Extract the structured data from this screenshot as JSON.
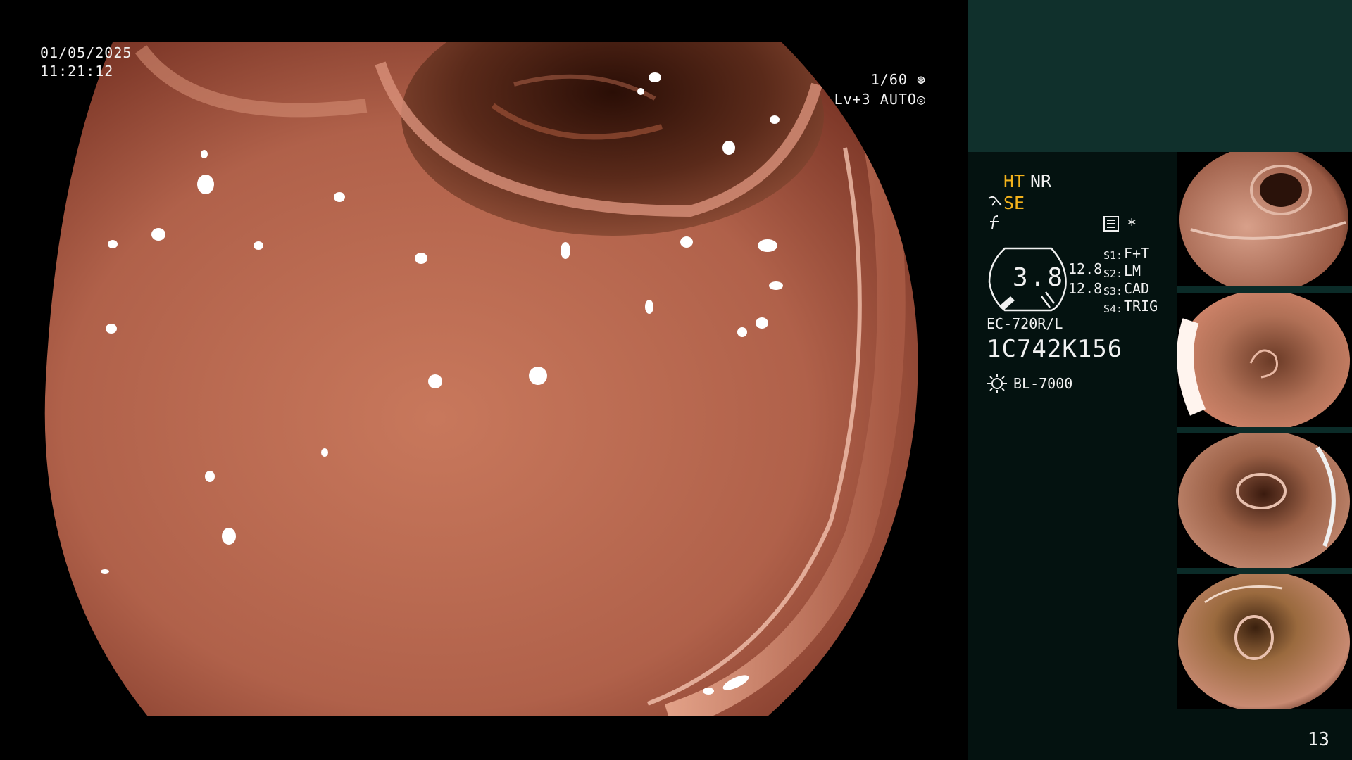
{
  "overlay": {
    "date": "01/05/2025",
    "time": "11:21:12",
    "shutter": "1/60",
    "shutter_icon": "aperture-icon",
    "level": "Lv+3",
    "exposure_mode": "AUTO",
    "exposure_icon": "iris-icon"
  },
  "panel": {
    "mode_ht": "HT",
    "mode_nr": "NR",
    "mode_se": "SE",
    "star": "*",
    "gauge_value": "3.8",
    "gauge_top": "12.8",
    "gauge_bottom": "12.8",
    "switches": [
      {
        "label": "S1:",
        "value": "F+T"
      },
      {
        "label": "S2:",
        "value": "LM"
      },
      {
        "label": "S3:",
        "value": "CAD"
      },
      {
        "label": "S4:",
        "value": "TRIG"
      }
    ],
    "scope_model": "EC-720R/L",
    "scope_serial": "1C742K156",
    "light_source": "BL-7000",
    "page_number": "13"
  },
  "colors": {
    "panel_bg": "#041210",
    "panel_top_bg": "#10302c",
    "accent_yellow": "#f3b21b",
    "mucosa": "#c06a4f"
  }
}
